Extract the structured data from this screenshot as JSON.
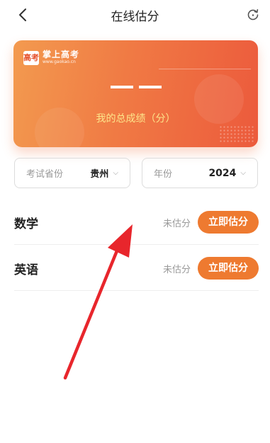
{
  "nav": {
    "title": "在线估分",
    "back_icon": "chevron-left-icon",
    "refresh_icon": "refresh-icon"
  },
  "card": {
    "logo_badge": "高考",
    "logo_name": "掌上高考",
    "logo_url": "www.gaokao.cn",
    "score": "——",
    "label": "我的总成绩（分）",
    "gradient_start": "#f39a4f",
    "gradient_end": "#ec5a3c",
    "label_color": "#fde58a"
  },
  "filters": {
    "province_label": "考试省份",
    "province_value": "贵州",
    "year_label": "年份",
    "year_value": "2024"
  },
  "subjects": [
    {
      "name": "数学",
      "status": "未估分",
      "button": "立即估分"
    },
    {
      "name": "英语",
      "status": "未估分",
      "button": "立即估分"
    }
  ],
  "colors": {
    "accent": "#ee7a30",
    "annotation_arrow": "#e8262c"
  }
}
